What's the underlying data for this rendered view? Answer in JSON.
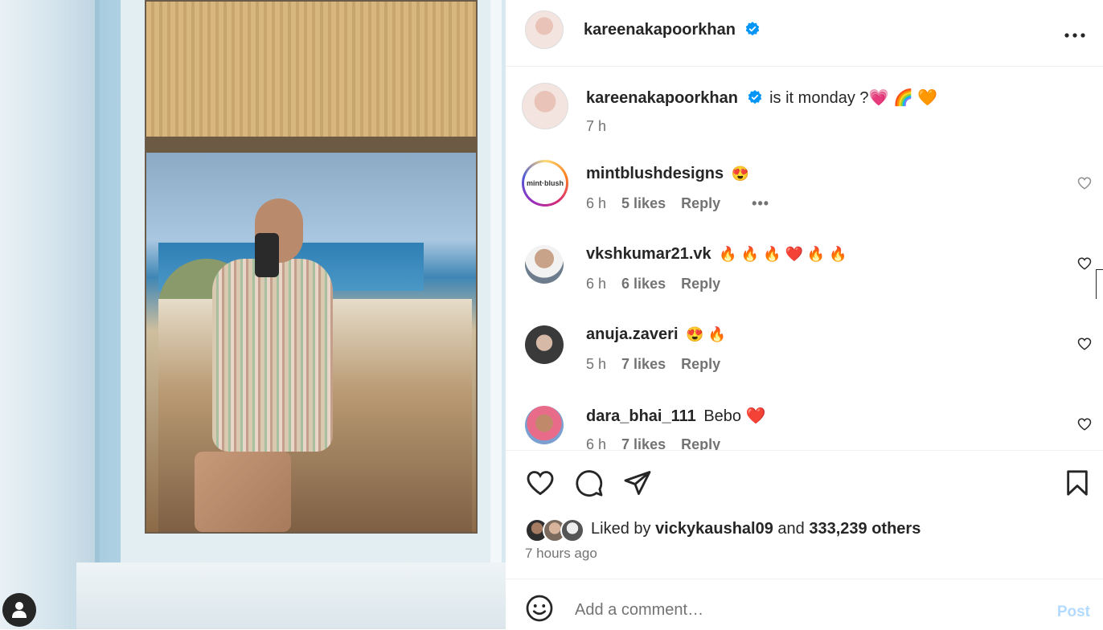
{
  "post": {
    "owner_username": "kareenakapoorkhan",
    "more_icon": "more-horizontal-icon",
    "caption": {
      "username": "kareenakapoorkhan",
      "text": "is it monday ?💗 🌈 🧡",
      "time": "7 h"
    }
  },
  "comments": [
    {
      "username": "mintblushdesigns",
      "text": "😍",
      "time": "6 h",
      "likes": "5 likes",
      "reply": "Reply",
      "more": "•••",
      "avatar_label": "mint·blush"
    },
    {
      "username": "vkshkumar21.vk",
      "text": "🔥 🔥 🔥 ❤️ 🔥 🔥",
      "time": "6 h",
      "likes": "6 likes",
      "reply": "Reply"
    },
    {
      "username": "anuja.zaveri",
      "text": "😍 🔥",
      "time": "5 h",
      "likes": "7 likes",
      "reply": "Reply"
    },
    {
      "username": "dara_bhai_111",
      "text": "Bebo ❤️",
      "time": "6 h",
      "likes": "7 likes",
      "reply": "Reply"
    }
  ],
  "actions": {
    "like_icon": "heart-icon",
    "comment_icon": "comment-icon",
    "share_icon": "share-icon",
    "save_icon": "bookmark-icon"
  },
  "likes": {
    "prefix": "Liked by",
    "first_user": "vickykaushal09",
    "connector": "and",
    "others": "333,239 others"
  },
  "posted_ago": "7 hours ago",
  "add_comment": {
    "placeholder": "Add a comment…",
    "post_label": "Post",
    "emoji_icon": "emoji-icon"
  },
  "colors": {
    "verified": "#0095f6",
    "post_disabled": "#b3dbff",
    "text": "#262626",
    "muted": "#737373"
  }
}
